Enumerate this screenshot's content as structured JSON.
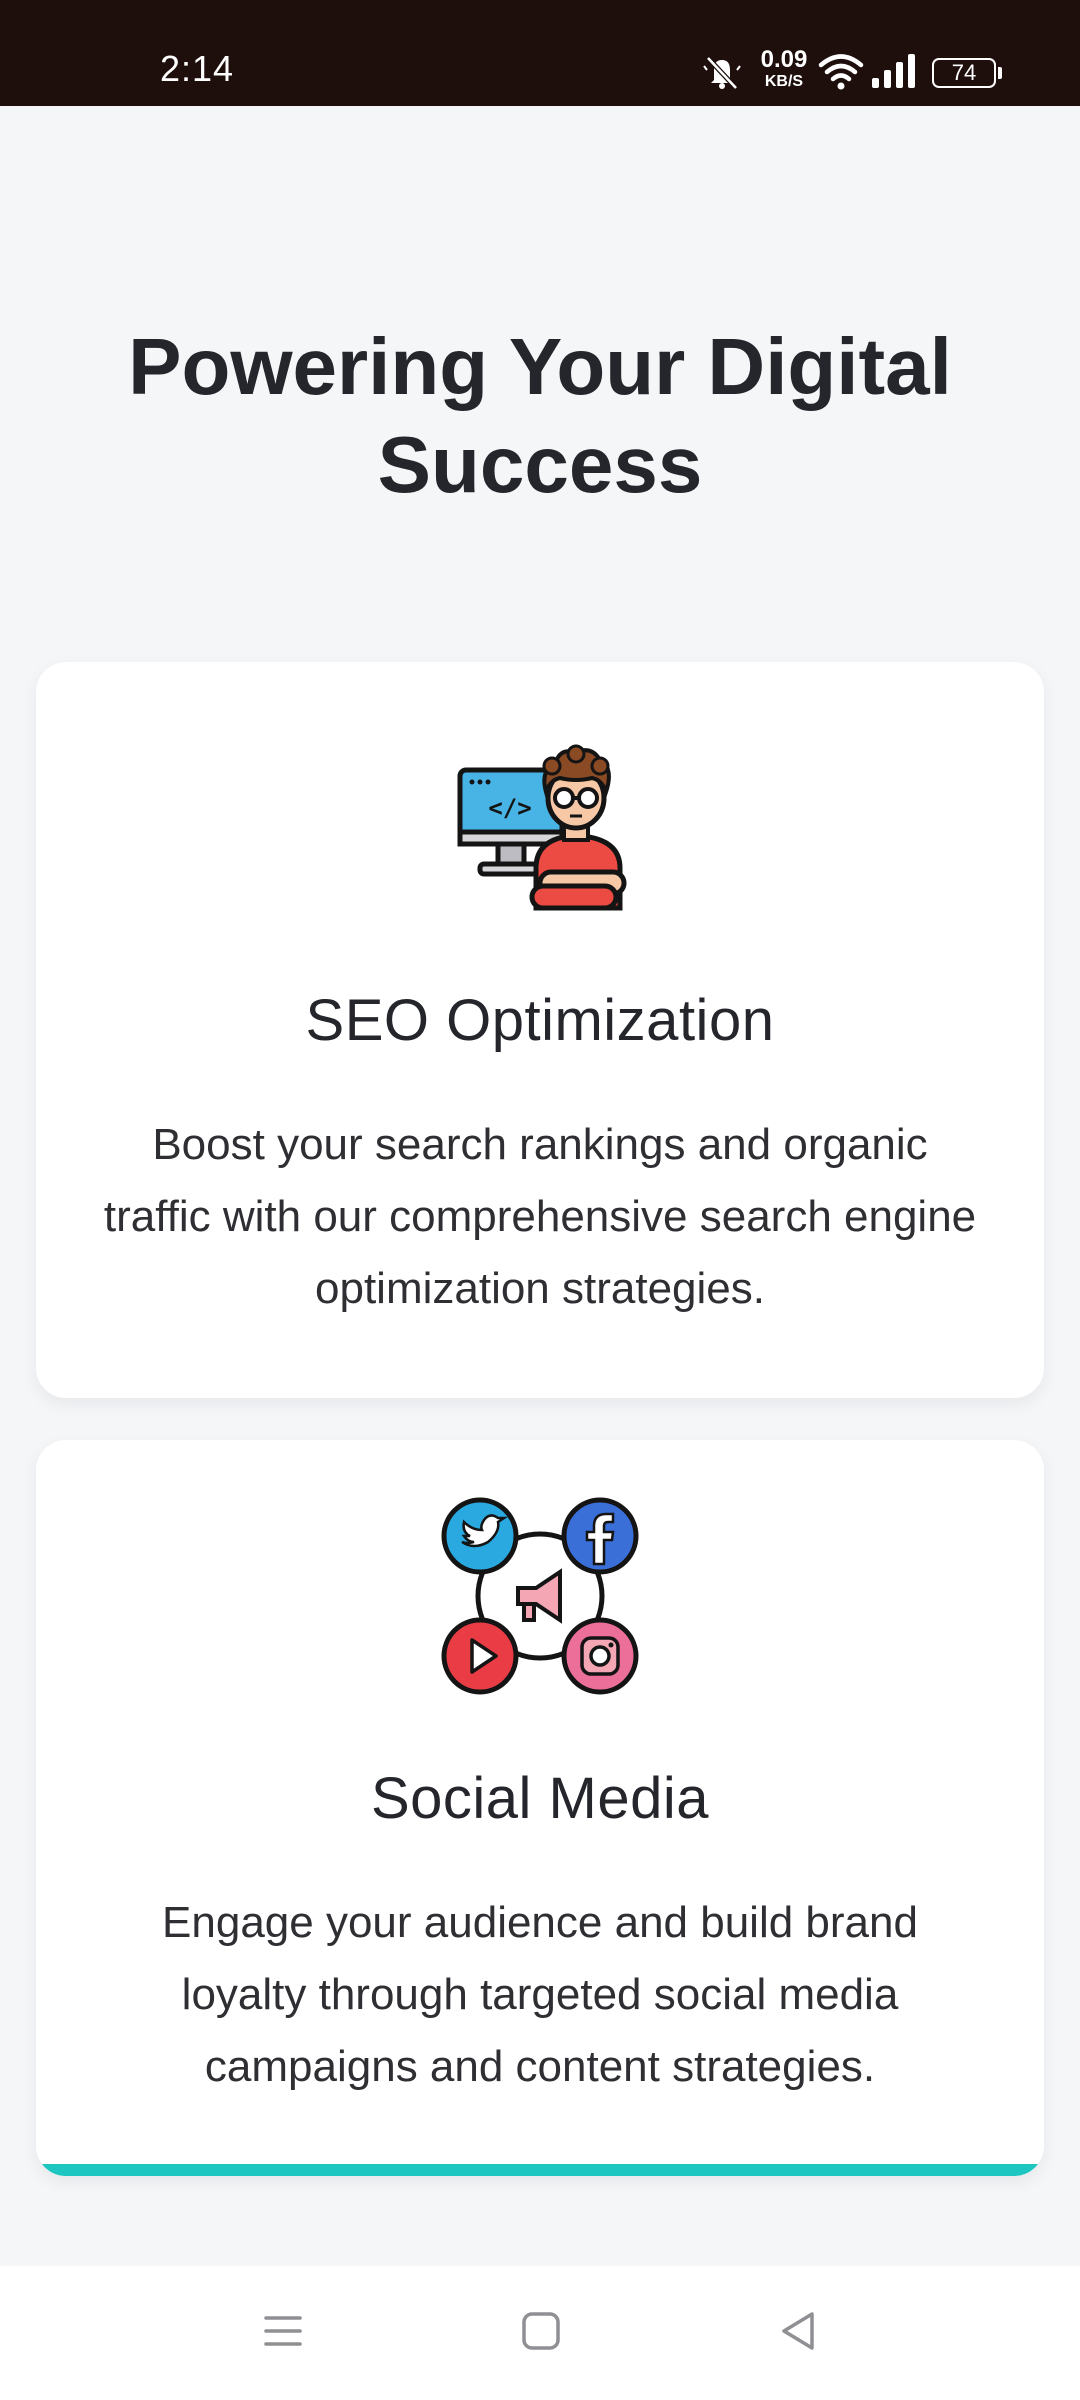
{
  "status_bar": {
    "time": "2:14",
    "net_speed_value": "0.09",
    "net_speed_unit": "KB/S",
    "battery": "74",
    "icons": [
      "mute-icon",
      "wifi-icon",
      "signal-icon",
      "battery-icon"
    ]
  },
  "page": {
    "title": "Powering Your Digital Success"
  },
  "services": [
    {
      "icon": "developer-icon",
      "title": "SEO Optimization",
      "description": "Boost your search rankings and organic traffic with our comprehensive search engine optimization strategies."
    },
    {
      "icon": "social-media-icon",
      "title": "Social Media",
      "description": "Engage your audience and build brand loyalty through targeted social media campaigns and content strategies."
    }
  ],
  "colors": {
    "accent": "#1ec6c2",
    "background": "#f5f6f8",
    "status_bar": "#1e0f0d"
  },
  "nav_bar": {
    "icons": [
      "menu-icon",
      "home-icon",
      "back-icon"
    ]
  }
}
